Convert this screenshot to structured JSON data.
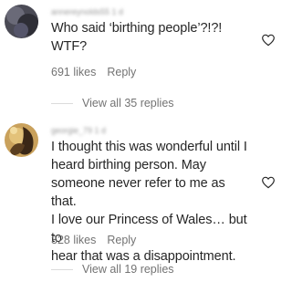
{
  "comments": [
    {
      "username": "annereynolds55 1 d",
      "text_lines": [
        "Who said ‘birthing people’?!?!",
        "WTF?"
      ],
      "likes": "691 likes",
      "reply_label": "Reply",
      "view_replies": "View all 35 replies",
      "heart_icon": "heart-outline-icon"
    },
    {
      "username": "georgie_79 1 d",
      "text_lines": [
        "I thought this was wonderful until I",
        "heard birthing person. May",
        "someone never refer to me as that.",
        "I love our Princess of Wales… but to",
        "hear that was a disappointment."
      ],
      "likes": "328 likes",
      "reply_label": "Reply",
      "view_replies": "View all 19 replies",
      "heart_icon": "heart-outline-icon"
    }
  ],
  "colors": {
    "text": "#262626",
    "secondary": "#737373",
    "divider": "#dbdbdb",
    "background": "#ffffff"
  }
}
